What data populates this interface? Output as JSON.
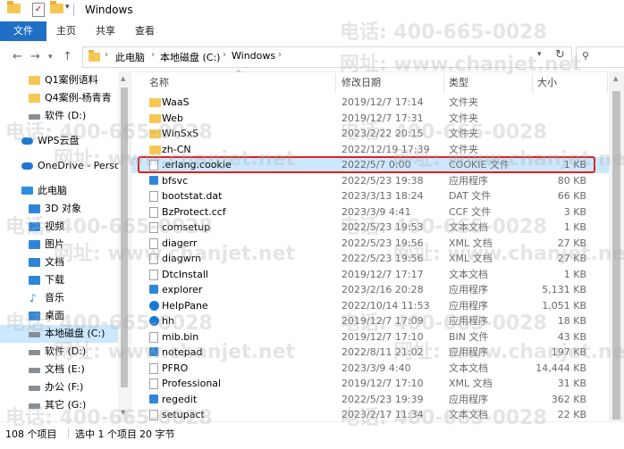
{
  "window": {
    "title": "Windows"
  },
  "ribbon": {
    "tabs": [
      "文件",
      "主页",
      "共享",
      "查看"
    ]
  },
  "address": {
    "crumbs": [
      "此电脑",
      "本地磁盘 (C:)",
      "Windows"
    ],
    "back_icon": "back-arrow-icon",
    "forward_icon": "forward-arrow-icon",
    "up_icon": "up-arrow-icon",
    "refresh_icon": "refresh-icon",
    "search_icon": "search-icon"
  },
  "sidebar": {
    "items": [
      {
        "label": "Q1案例语料",
        "icon": "folder"
      },
      {
        "label": "Q4案例-杨青青",
        "icon": "folder"
      },
      {
        "label": "软件 (D:)",
        "icon": "drive"
      },
      {
        "label": "WPS云盘",
        "icon": "cloud"
      },
      {
        "label": "OneDrive - Person",
        "icon": "cloud"
      },
      {
        "label": "此电脑",
        "icon": "pc"
      },
      {
        "label": "3D 对象",
        "icon": "blue"
      },
      {
        "label": "视频",
        "icon": "blue"
      },
      {
        "label": "图片",
        "icon": "blue"
      },
      {
        "label": "文档",
        "icon": "blue"
      },
      {
        "label": "下载",
        "icon": "blue"
      },
      {
        "label": "音乐",
        "icon": "music"
      },
      {
        "label": "桌面",
        "icon": "blue"
      },
      {
        "label": "本地磁盘 (C:)",
        "icon": "drive",
        "selected": true
      },
      {
        "label": "软件 (D:)",
        "icon": "drive"
      },
      {
        "label": "文档 (E:)",
        "icon": "drive"
      },
      {
        "label": "办公 (F:)",
        "icon": "drive"
      },
      {
        "label": "其它 (G:)",
        "icon": "drive"
      }
    ]
  },
  "columns": {
    "name": "名称",
    "date": "修改日期",
    "type": "类型",
    "size": "大小"
  },
  "files": [
    {
      "name": "WaaS",
      "date": "2019/12/7 17:14",
      "type": "文件夹",
      "size": "",
      "icon": "folder"
    },
    {
      "name": "Web",
      "date": "2019/12/7 17:31",
      "type": "文件夹",
      "size": "",
      "icon": "folder"
    },
    {
      "name": "WinSxS",
      "date": "2023/2/22 20:15",
      "type": "文件夹",
      "size": "",
      "icon": "folder"
    },
    {
      "name": "zh-CN",
      "date": "2022/12/19 17:39",
      "type": "文件夹",
      "size": "",
      "icon": "folder"
    },
    {
      "name": ".erlang.cookie",
      "date": "2022/5/7 0:00",
      "type": "COOKIE 文件",
      "size": "1 KB",
      "icon": "file",
      "selected": true
    },
    {
      "name": "bfsvc",
      "date": "2022/5/23 19:38",
      "type": "应用程序",
      "size": "80 KB",
      "icon": "exe"
    },
    {
      "name": "bootstat.dat",
      "date": "2023/3/13 18:24",
      "type": "DAT 文件",
      "size": "66 KB",
      "icon": "file"
    },
    {
      "name": "BzProtect.ccf",
      "date": "2023/3/9 4:41",
      "type": "CCF 文件",
      "size": "3 KB",
      "icon": "file"
    },
    {
      "name": "comsetup",
      "date": "2022/5/23 19:53",
      "type": "文本文档",
      "size": "1 KB",
      "icon": "file"
    },
    {
      "name": "diagerr",
      "date": "2022/5/23 19:56",
      "type": "XML 文档",
      "size": "27 KB",
      "icon": "file"
    },
    {
      "name": "diagwrn",
      "date": "2022/5/23 19:56",
      "type": "XML 文档",
      "size": "27 KB",
      "icon": "file"
    },
    {
      "name": "DtcInstall",
      "date": "2019/12/7 17:17",
      "type": "文本文档",
      "size": "1 KB",
      "icon": "file"
    },
    {
      "name": "explorer",
      "date": "2023/2/16 20:28",
      "type": "应用程序",
      "size": "5,131 KB",
      "icon": "exe"
    },
    {
      "name": "HelpPane",
      "date": "2022/10/14 11:53",
      "type": "应用程序",
      "size": "1,051 KB",
      "icon": "help"
    },
    {
      "name": "hh",
      "date": "2019/12/7 17:09",
      "type": "应用程序",
      "size": "18 KB",
      "icon": "help"
    },
    {
      "name": "mib.bin",
      "date": "2019/12/7 17:10",
      "type": "BIN 文件",
      "size": "43 KB",
      "icon": "file"
    },
    {
      "name": "notepad",
      "date": "2022/8/11 21:02",
      "type": "应用程序",
      "size": "197 KB",
      "icon": "exe"
    },
    {
      "name": "PFRO",
      "date": "2023/3/9 4:40",
      "type": "文本文档",
      "size": "14,444 KB",
      "icon": "file"
    },
    {
      "name": "Professional",
      "date": "2019/12/7 17:10",
      "type": "XML 文档",
      "size": "31 KB",
      "icon": "file"
    },
    {
      "name": "regedit",
      "date": "2022/5/23 19:39",
      "type": "应用程序",
      "size": "362 KB",
      "icon": "exe"
    },
    {
      "name": "setupact",
      "date": "2023/2/17 11:34",
      "type": "文本文档",
      "size": "22 KB",
      "icon": "file"
    }
  ],
  "status": {
    "count": "108 个项目",
    "selected": "选中 1 个项目",
    "size": "20 字节"
  },
  "watermark": {
    "phone": "电话: 400-665-0028",
    "site": "网址: www.chanjet.net"
  },
  "colors": {
    "accent": "#1e6fc5",
    "selection": "#cce8ff",
    "highlight_border": "#e02020",
    "folder": "#f6c853"
  }
}
